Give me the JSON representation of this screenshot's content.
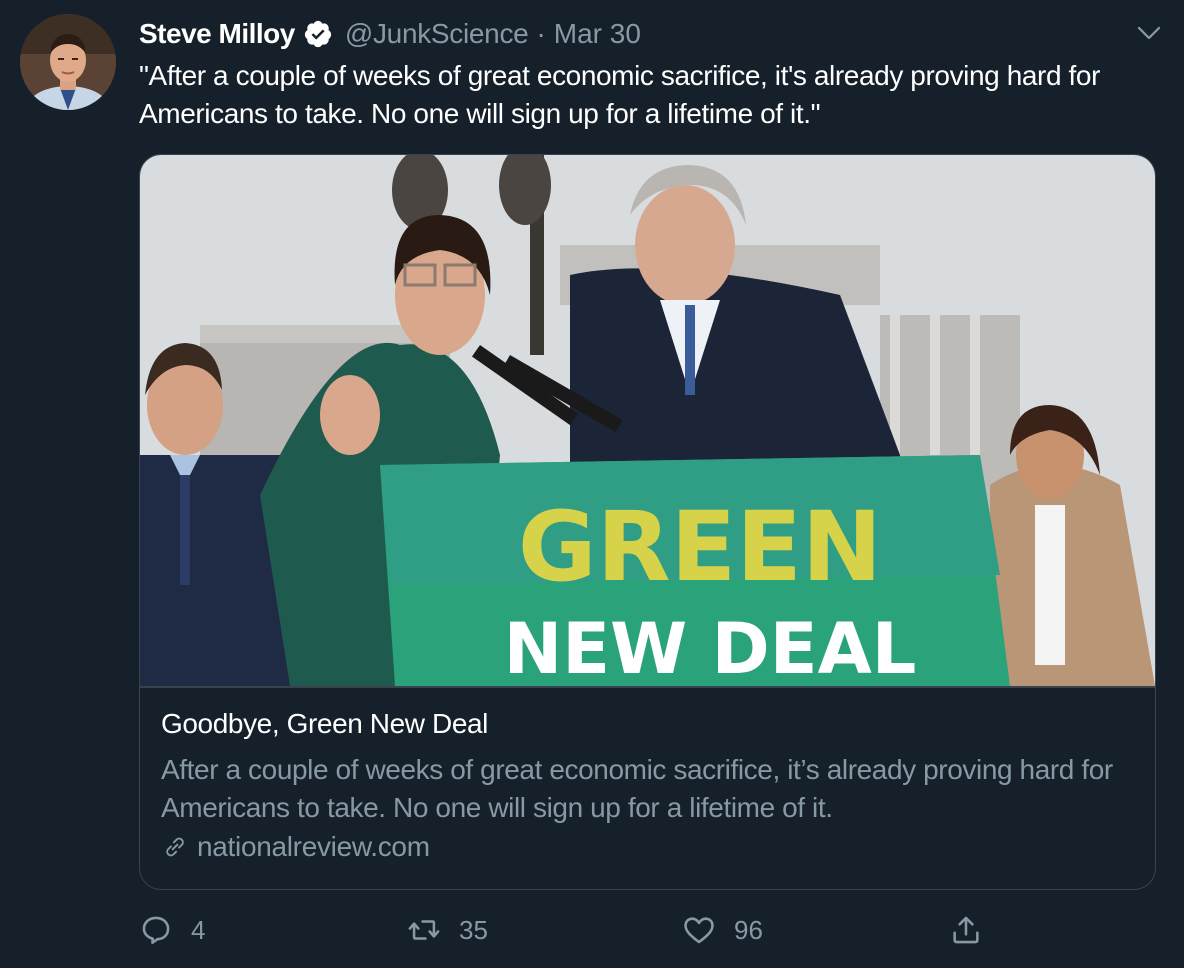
{
  "tweet": {
    "author_name": "Steve Milloy",
    "author_handle": "@JunkScience",
    "separator": "·",
    "time": "Mar 30",
    "text": "\"After a couple of weeks of great economic sacrifice, it's already proving hard for Americans to take. No one will sign up for a lifetime of it.\""
  },
  "card": {
    "image_text_line1": "GREEN",
    "image_text_line2": "NEW DEAL",
    "title": "Goodbye, Green New Deal",
    "description": "After a couple of weeks of great economic sacrifice, it’s already proving hard for Americans to take. No one will sign up for a lifetime of it.",
    "domain": "nationalreview.com"
  },
  "actions": {
    "reply_count": "4",
    "retweet_count": "35",
    "like_count": "96"
  },
  "icons": {
    "verified": "verified-badge-icon",
    "caret": "chevron-down-icon",
    "link": "link-icon",
    "reply": "reply-icon",
    "retweet": "retweet-icon",
    "like": "heart-icon",
    "share": "share-icon"
  },
  "colors": {
    "background": "#15202b",
    "border": "#38444d",
    "secondary_text": "#8899a6",
    "primary_text": "#ffffff",
    "sign_green": "#2aa37a",
    "sign_yellow": "#d6d24a"
  }
}
